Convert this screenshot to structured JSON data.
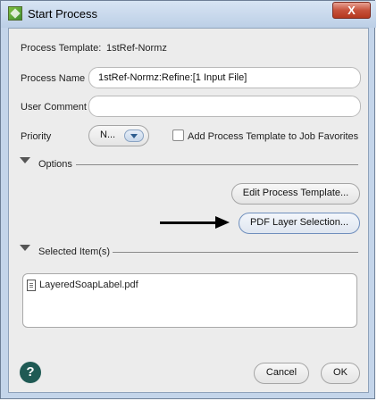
{
  "window": {
    "title": "Start  Process",
    "close_label": "X"
  },
  "form": {
    "process_template_label": "Process Template:",
    "process_template_value": "1stRef-Normz",
    "process_name_label": "Process Name",
    "process_name_value": "1stRef-Normz:Refine:[1 Input File]",
    "user_comment_label": "User Comment",
    "user_comment_value": "",
    "priority_label": "Priority",
    "priority_value": "N...",
    "favorites_label": "Add Process Template to Job Favorites",
    "favorites_checked": false
  },
  "options": {
    "header": "Options",
    "edit_template_button": "Edit Process Template...",
    "pdf_layer_button": "PDF Layer Selection..."
  },
  "selected": {
    "header": "Selected Item(s)",
    "items": [
      "LayeredSoapLabel.pdf"
    ]
  },
  "footer": {
    "help_label": "?",
    "cancel_label": "Cancel",
    "ok_label": "OK"
  },
  "colors": {
    "titlebar": "#c4d5ea",
    "close": "#c7523c",
    "help": "#1f5a54",
    "dialog_bg": "#ececec"
  }
}
